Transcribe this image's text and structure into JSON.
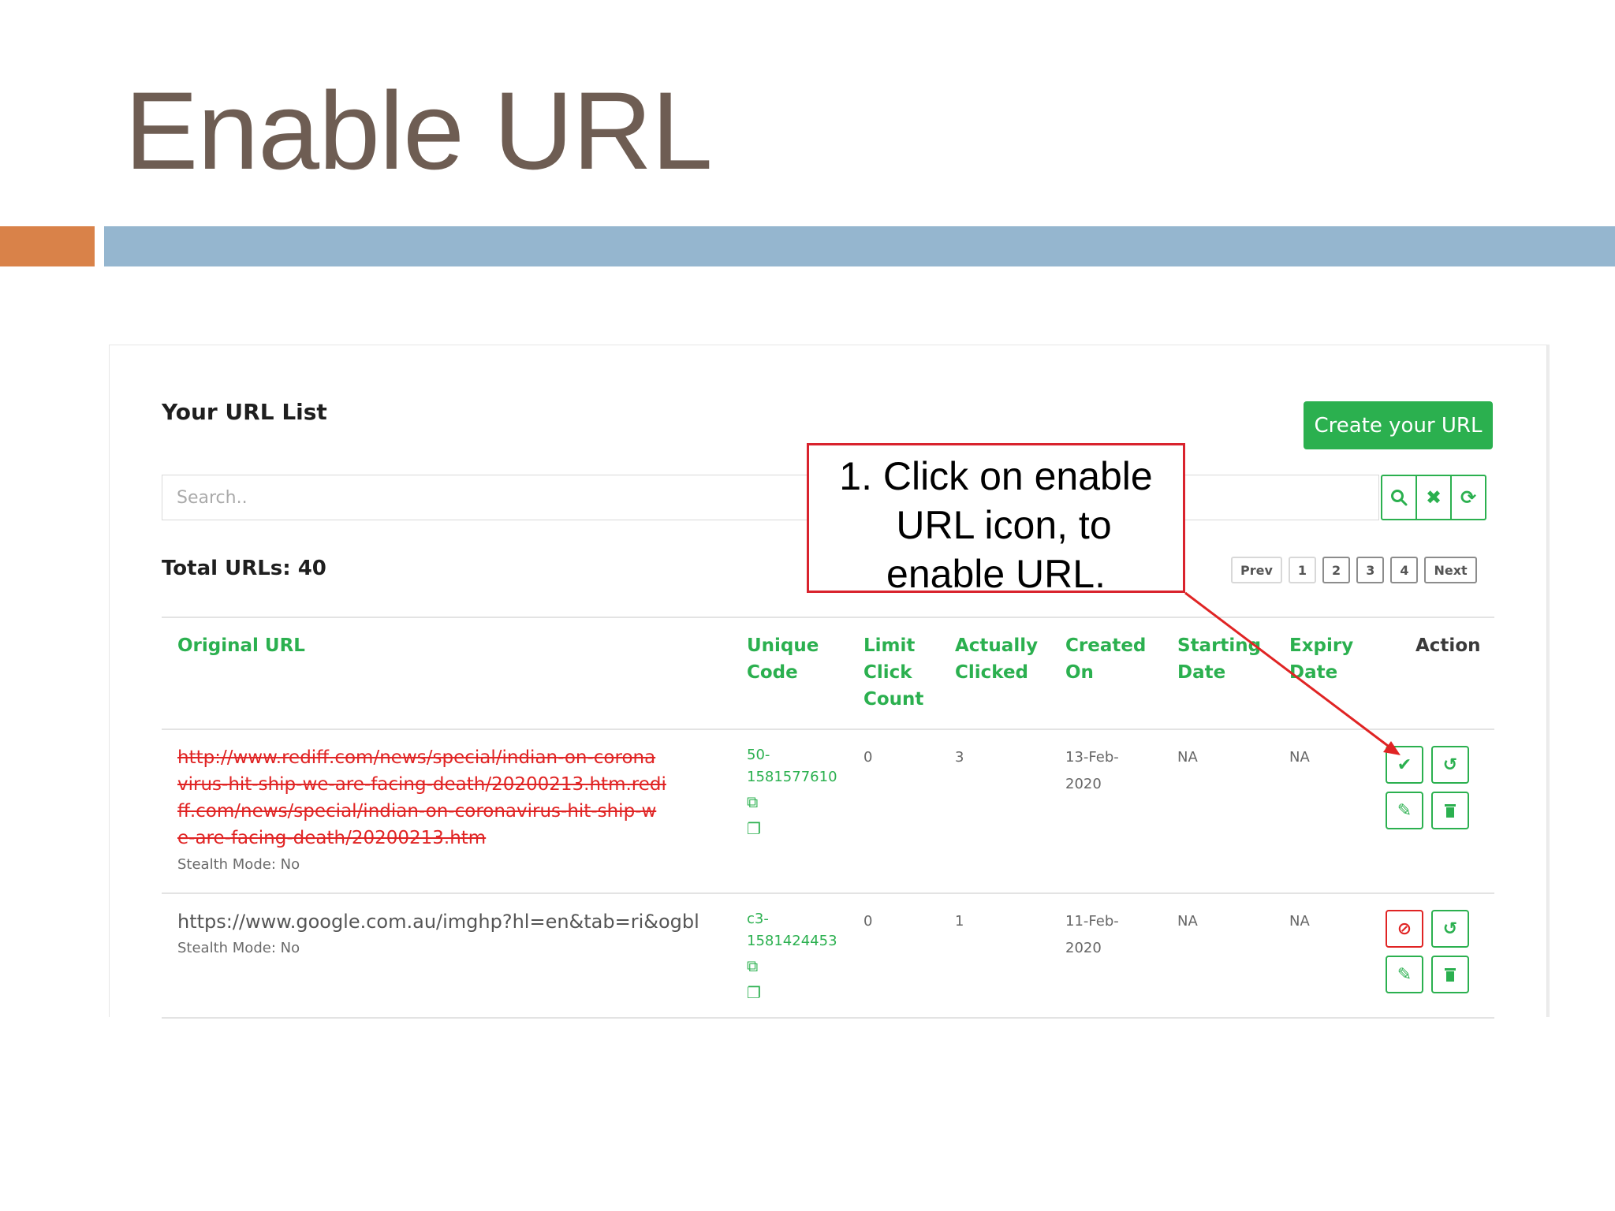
{
  "slide": {
    "title": "Enable URL"
  },
  "panel": {
    "title": "Your URL List",
    "create_button": "Create your URL",
    "search": {
      "placeholder": "Search..",
      "value": ""
    },
    "total_label": "Total URLs: 40",
    "pagination": {
      "prev": "Prev",
      "pages": [
        "1",
        "2",
        "3",
        "4"
      ],
      "next": "Next"
    },
    "columns": {
      "original_url": "Original URL",
      "unique_code_1": "Unique",
      "unique_code_2": "Code",
      "limit_1": "Limit",
      "limit_2": "Click",
      "limit_3": "Count",
      "actual_1": "Actually",
      "actual_2": "Clicked",
      "created_1": "Created",
      "created_2": "On",
      "start_1": "Starting",
      "start_2": "Date",
      "expiry_1": "Expiry",
      "expiry_2": "Date",
      "action": "Action"
    },
    "rows": [
      {
        "url": "http://www.rediff.com/news/special/indian-on-corona virus-hit-ship-we-are-facing-death/20200213.htm.rediff.com/news/special/indian-on-coronavirus-hit-ship-we-are-facing-death/20200213.htm",
        "stealth": "Stealth Mode: No",
        "code_1": "50-",
        "code_2": "1581577610",
        "limit": "0",
        "clicked": "3",
        "created_1": "13-Feb-",
        "created_2": "2020",
        "start": "NA",
        "expiry": "NA",
        "status": "disabled"
      },
      {
        "url": "https://www.google.com.au/imghp?hl=en&tab=ri&ogbl",
        "stealth": "Stealth Mode: No",
        "code_1": "c3-",
        "code_2": "1581424453",
        "limit": "0",
        "clicked": "1",
        "created_1": "11-Feb-",
        "created_2": "2020",
        "start": "NA",
        "expiry": "NA",
        "status": "enabled"
      }
    ]
  },
  "callout": {
    "line1": "1. Click on enable",
    "line2": "URL icon, to",
    "line3": "enable URL."
  },
  "icons": {
    "search": "search-icon",
    "clear": "close-icon",
    "refresh": "refresh-icon",
    "enable": "check-icon",
    "disable": "ban-icon",
    "reset": "history-icon",
    "edit": "pencil-icon",
    "delete": "trash-icon",
    "open": "external-link-icon",
    "copy": "copy-icon"
  },
  "colors": {
    "accent_green": "#2bb04f",
    "disabled_red": "#e02424",
    "callout_red": "#d9232d",
    "bar_orange": "#d98249",
    "bar_blue": "#95b6cf"
  }
}
